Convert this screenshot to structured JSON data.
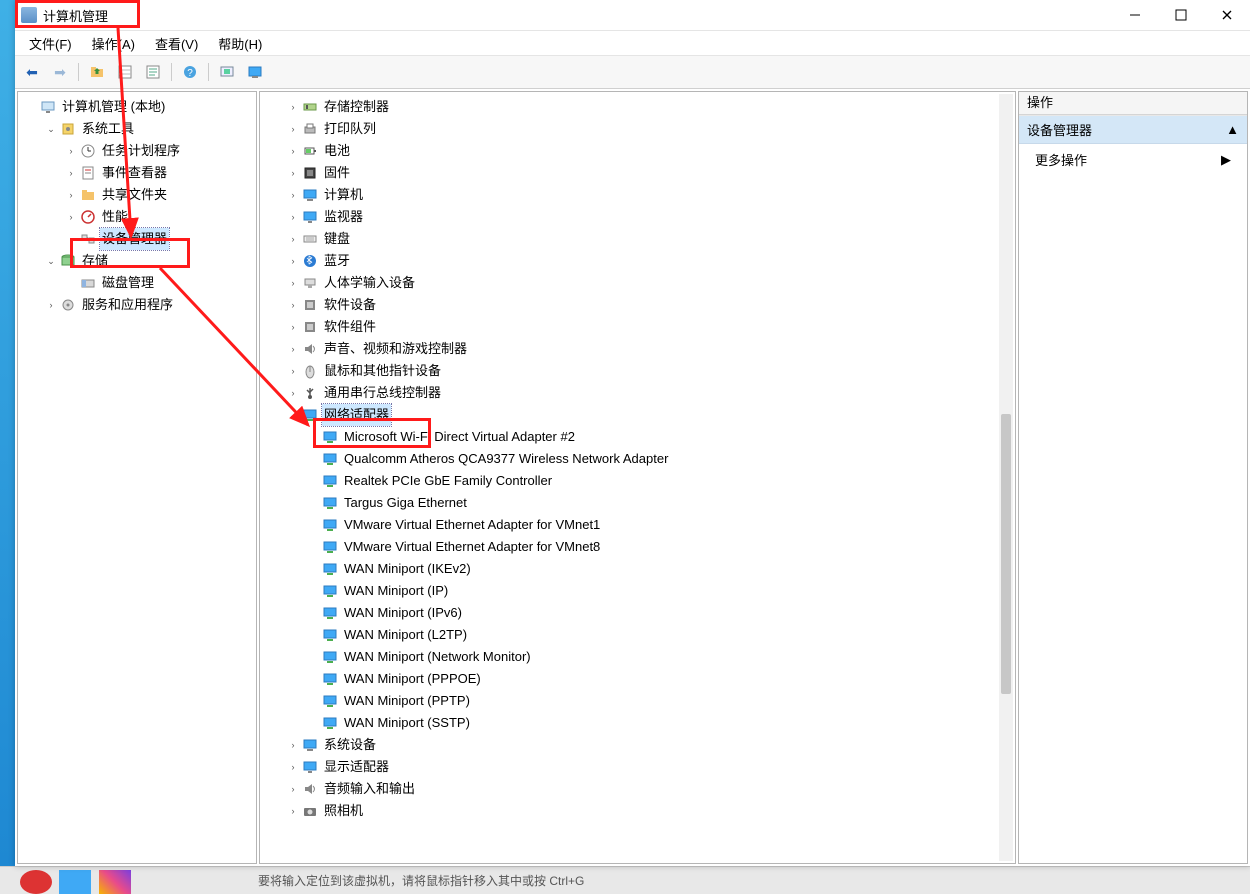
{
  "title": "计算机管理",
  "menubar": [
    "文件(F)",
    "操作(A)",
    "查看(V)",
    "帮助(H)"
  ],
  "toolbar_icons": [
    "back-arrow-icon",
    "forward-arrow-icon",
    "up-folder-icon",
    "list-icon",
    "properties-icon",
    "refresh-icon",
    "help-icon",
    "scan-hardware-icon",
    "show-hidden-icon"
  ],
  "left_tree": [
    {
      "depth": 0,
      "exp": "",
      "icon": "computer-management-icon",
      "label": "计算机管理 (本地)"
    },
    {
      "depth": 1,
      "exp": "open",
      "icon": "system-tools-icon",
      "label": "系统工具"
    },
    {
      "depth": 2,
      "exp": "closed",
      "icon": "task-scheduler-icon",
      "label": "任务计划程序"
    },
    {
      "depth": 2,
      "exp": "closed",
      "icon": "event-viewer-icon",
      "label": "事件查看器"
    },
    {
      "depth": 2,
      "exp": "closed",
      "icon": "shared-folders-icon",
      "label": "共享文件夹"
    },
    {
      "depth": 2,
      "exp": "closed",
      "icon": "performance-icon",
      "label": "性能"
    },
    {
      "depth": 2,
      "exp": "",
      "icon": "device-manager-icon",
      "label": "设备管理器",
      "selected": true
    },
    {
      "depth": 1,
      "exp": "open",
      "icon": "storage-icon",
      "label": "存储"
    },
    {
      "depth": 2,
      "exp": "",
      "icon": "disk-management-icon",
      "label": "磁盘管理"
    },
    {
      "depth": 1,
      "exp": "closed",
      "icon": "services-apps-icon",
      "label": "服务和应用程序"
    }
  ],
  "center_tree": [
    {
      "depth": 1,
      "exp": "closed",
      "icon": "storage-controller-icon",
      "label": "存储控制器"
    },
    {
      "depth": 1,
      "exp": "closed",
      "icon": "print-queue-icon",
      "label": "打印队列"
    },
    {
      "depth": 1,
      "exp": "closed",
      "icon": "battery-icon",
      "label": "电池"
    },
    {
      "depth": 1,
      "exp": "closed",
      "icon": "firmware-icon",
      "label": "固件"
    },
    {
      "depth": 1,
      "exp": "closed",
      "icon": "computer-icon",
      "label": "计算机"
    },
    {
      "depth": 1,
      "exp": "closed",
      "icon": "monitor-icon",
      "label": "监视器"
    },
    {
      "depth": 1,
      "exp": "closed",
      "icon": "keyboard-icon",
      "label": "键盘"
    },
    {
      "depth": 1,
      "exp": "closed",
      "icon": "bluetooth-icon",
      "label": "蓝牙"
    },
    {
      "depth": 1,
      "exp": "closed",
      "icon": "hid-icon",
      "label": "人体学输入设备"
    },
    {
      "depth": 1,
      "exp": "closed",
      "icon": "software-device-icon",
      "label": "软件设备"
    },
    {
      "depth": 1,
      "exp": "closed",
      "icon": "software-component-icon",
      "label": "软件组件"
    },
    {
      "depth": 1,
      "exp": "closed",
      "icon": "sound-video-game-icon",
      "label": "声音、视频和游戏控制器"
    },
    {
      "depth": 1,
      "exp": "closed",
      "icon": "mouse-icon",
      "label": "鼠标和其他指针设备"
    },
    {
      "depth": 1,
      "exp": "closed",
      "icon": "usb-icon",
      "label": "通用串行总线控制器"
    },
    {
      "depth": 1,
      "exp": "open",
      "icon": "network-adapter-icon",
      "label": "网络适配器",
      "selected": true
    },
    {
      "depth": 2,
      "exp": "",
      "icon": "net-icon",
      "label": "Microsoft Wi-Fi Direct Virtual Adapter #2"
    },
    {
      "depth": 2,
      "exp": "",
      "icon": "net-icon",
      "label": "Qualcomm Atheros QCA9377 Wireless Network Adapter"
    },
    {
      "depth": 2,
      "exp": "",
      "icon": "net-icon",
      "label": "Realtek PCIe GbE Family Controller"
    },
    {
      "depth": 2,
      "exp": "",
      "icon": "net-icon",
      "label": "Targus Giga Ethernet"
    },
    {
      "depth": 2,
      "exp": "",
      "icon": "net-icon",
      "label": "VMware Virtual Ethernet Adapter for VMnet1"
    },
    {
      "depth": 2,
      "exp": "",
      "icon": "net-icon",
      "label": "VMware Virtual Ethernet Adapter for VMnet8"
    },
    {
      "depth": 2,
      "exp": "",
      "icon": "net-icon",
      "label": "WAN Miniport (IKEv2)"
    },
    {
      "depth": 2,
      "exp": "",
      "icon": "net-icon",
      "label": "WAN Miniport (IP)"
    },
    {
      "depth": 2,
      "exp": "",
      "icon": "net-icon",
      "label": "WAN Miniport (IPv6)"
    },
    {
      "depth": 2,
      "exp": "",
      "icon": "net-icon",
      "label": "WAN Miniport (L2TP)"
    },
    {
      "depth": 2,
      "exp": "",
      "icon": "net-icon",
      "label": "WAN Miniport (Network Monitor)"
    },
    {
      "depth": 2,
      "exp": "",
      "icon": "net-icon",
      "label": "WAN Miniport (PPPOE)"
    },
    {
      "depth": 2,
      "exp": "",
      "icon": "net-icon",
      "label": "WAN Miniport (PPTP)"
    },
    {
      "depth": 2,
      "exp": "",
      "icon": "net-icon",
      "label": "WAN Miniport (SSTP)"
    },
    {
      "depth": 1,
      "exp": "closed",
      "icon": "system-device-icon",
      "label": "系统设备"
    },
    {
      "depth": 1,
      "exp": "closed",
      "icon": "display-adapter-icon",
      "label": "显示适配器"
    },
    {
      "depth": 1,
      "exp": "closed",
      "icon": "audio-io-icon",
      "label": "音频输入和输出"
    },
    {
      "depth": 1,
      "exp": "closed",
      "icon": "camera-icon",
      "label": "照相机"
    }
  ],
  "right_pane": {
    "header": "操作",
    "group_header": "设备管理器",
    "item": "更多操作"
  },
  "statusbar_hint": "要将输入定位到该虚拟机，请将鼠标指针移入其中或按 Ctrl+G"
}
